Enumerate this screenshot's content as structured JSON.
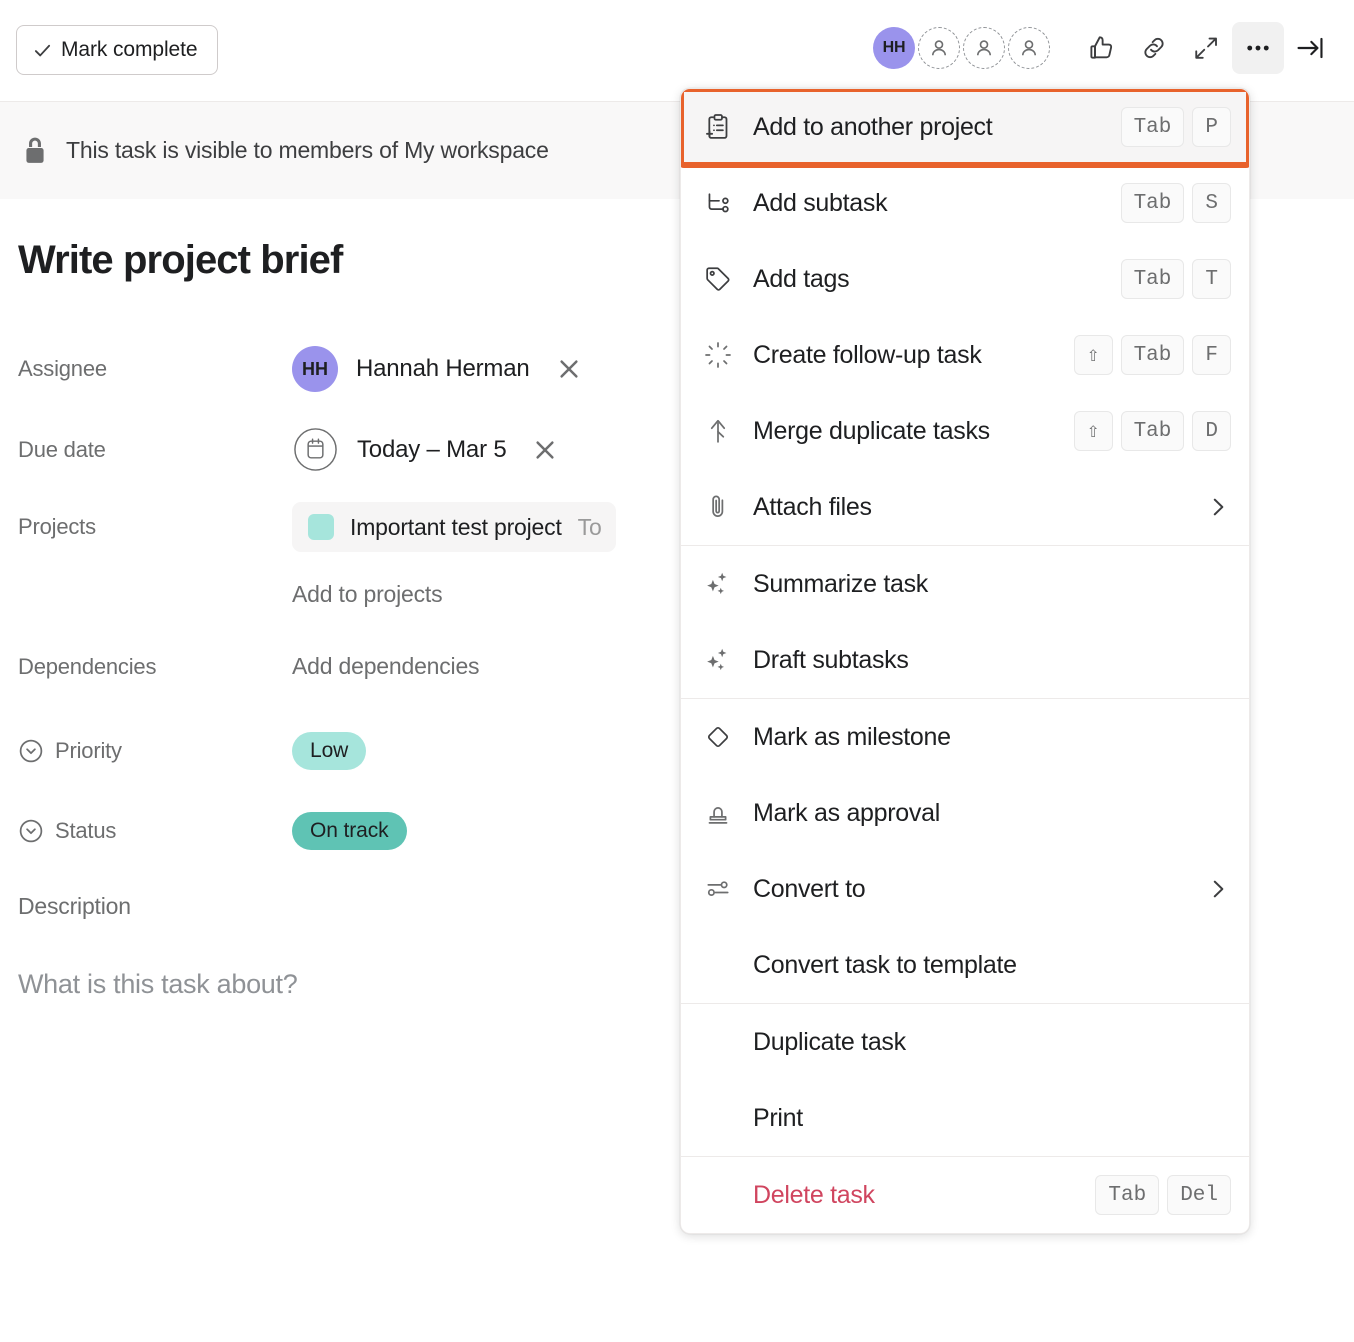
{
  "toolbar": {
    "mark_complete_label": "Mark complete",
    "check_icon": "check-icon",
    "avatar_initials": "HH",
    "ghost_avatars": 3,
    "icons": [
      {
        "name": "thumbs-up-icon",
        "label": "Like"
      },
      {
        "name": "link-icon",
        "label": "Copy task link"
      },
      {
        "name": "expand-icon",
        "label": "Full screen"
      },
      {
        "name": "more-options-icon",
        "label": "More actions"
      },
      {
        "name": "collapse-panel-icon",
        "label": "Close details"
      }
    ]
  },
  "banner": {
    "lock_icon": "lock-icon",
    "text": "This task is visible to members of My workspace and its public",
    "text_visible": "This task is visible to members of My workspace",
    "text_tail": "blic"
  },
  "task": {
    "title": "Write project brief",
    "fields": {
      "assignee_label": "Assignee",
      "assignee_initials": "HH",
      "assignee_name": "Hannah Herman",
      "due_date_label": "Due date",
      "due_date_value": "Today – Mar 5",
      "projects_label": "Projects",
      "project_name": "Important test project",
      "project_section": "To",
      "project_color": "#a6e5dc",
      "add_to_projects": "Add to projects",
      "dependencies_label": "Dependencies",
      "add_dependencies": "Add dependencies",
      "priority_label": "Priority",
      "priority_value": "Low",
      "status_label": "Status",
      "status_value": "On track",
      "description_label": "Description",
      "description_placeholder": "What is this task about?"
    }
  },
  "menu": {
    "sections": [
      {
        "items": [
          {
            "icon": "add-to-project-icon",
            "label": "Add to another project",
            "keys": [
              "Tab",
              "P"
            ],
            "highlighted": true
          },
          {
            "icon": "subtask-icon",
            "label": "Add subtask",
            "keys": [
              "Tab",
              "S"
            ]
          },
          {
            "icon": "tag-icon",
            "label": "Add tags",
            "keys": [
              "Tab",
              "T"
            ]
          },
          {
            "icon": "follow-up-icon",
            "label": "Create follow-up task",
            "keys": [
              "⇧",
              "Tab",
              "F"
            ]
          },
          {
            "icon": "merge-icon",
            "label": "Merge duplicate tasks",
            "keys": [
              "⇧",
              "Tab",
              "D"
            ]
          },
          {
            "icon": "paperclip-icon",
            "label": "Attach files",
            "submenu": true
          }
        ]
      },
      {
        "items": [
          {
            "icon": "sparkle-icon",
            "label": "Summarize task"
          },
          {
            "icon": "sparkle-icon",
            "label": "Draft subtasks"
          }
        ]
      },
      {
        "items": [
          {
            "icon": "diamond-icon",
            "label": "Mark as milestone"
          },
          {
            "icon": "stamp-icon",
            "label": "Mark as approval"
          },
          {
            "icon": "convert-icon",
            "label": "Convert to",
            "submenu": true
          },
          {
            "icon": "none",
            "label": "Convert task to template"
          }
        ]
      },
      {
        "items": [
          {
            "icon": "none",
            "label": "Duplicate task"
          },
          {
            "icon": "none",
            "label": "Print"
          }
        ]
      },
      {
        "items": [
          {
            "icon": "none",
            "label": "Delete task",
            "keys": [
              "Tab",
              "Del"
            ],
            "danger": true
          }
        ]
      }
    ]
  },
  "colors": {
    "accent_orange": "#e8622c",
    "avatar_purple": "#9a93ec",
    "teal_light": "#a6e5dc",
    "teal": "#5fc3b4",
    "danger_red": "#d0455f"
  }
}
